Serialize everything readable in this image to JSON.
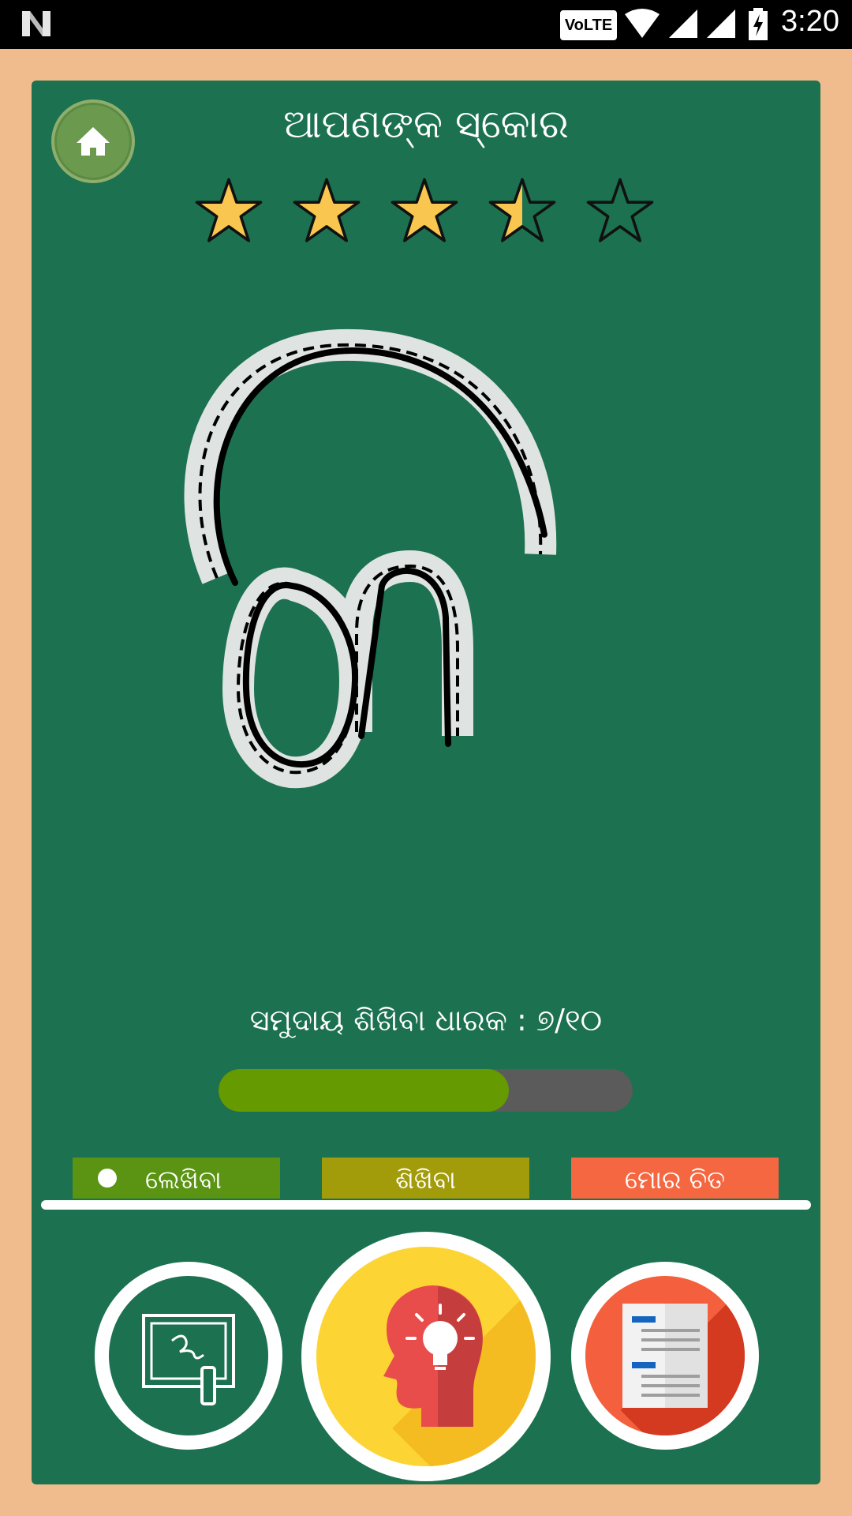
{
  "status_bar": {
    "time": "3:20",
    "volte": "VoLTE"
  },
  "header": {
    "title": "ଆପଣଙ୍କ ସ୍କୋର",
    "rating": 3.5,
    "rating_max": 5
  },
  "colors": {
    "page_bg": "#f0bb8d",
    "board_bg": "#1b7150",
    "star_fill": "#f9c74f",
    "progress_fill": "#659a00",
    "progress_track": "#5b5b5b",
    "tab_write": "#5a9412",
    "tab_learn": "#a39c0a",
    "tab_mypic": "#f46741"
  },
  "trace": {
    "glyph_icon": "odia-letter-trace"
  },
  "summary": {
    "caption": "ସମୁଦାୟ ଶିଖିବା ଧାରକ : ୭/୧୦",
    "progress_fraction": 0.7
  },
  "tabs": [
    {
      "label": "ଲେଖିବା",
      "selected": true
    },
    {
      "label": "ଶିଖିବା",
      "selected": false
    },
    {
      "label": "ମୋର ଚିତ",
      "selected": false
    }
  ],
  "buttons": {
    "write_icon": "drawing-board-icon",
    "learn_icon": "head-lightbulb-icon",
    "mypic_icon": "document-icon"
  }
}
